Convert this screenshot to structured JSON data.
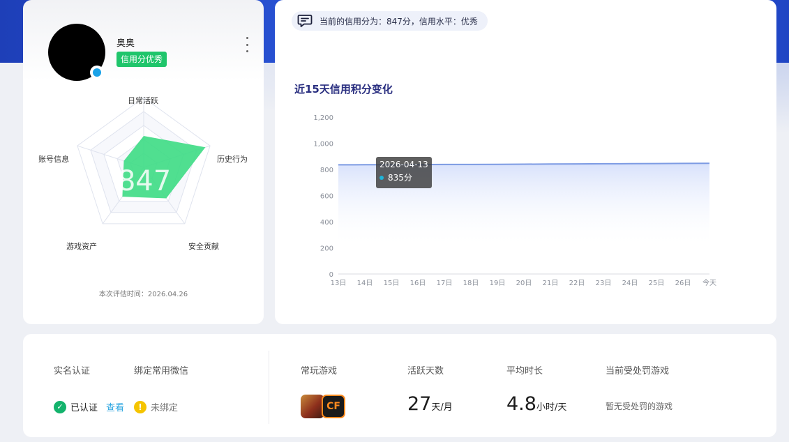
{
  "profile": {
    "nickname": "奥奥",
    "credit_tag": "信用分优秀",
    "score_watermark": "847",
    "eval_time": "本次评估时间：2026.04.26",
    "radar": {
      "axes": [
        "日常活跃",
        "历史行为",
        "安全贡献",
        "游戏资产",
        "账号信息"
      ],
      "values": [
        0.45,
        0.93,
        0.55,
        0.52,
        0.3
      ],
      "fill_color": "#3ddc84"
    }
  },
  "notice": {
    "text": "当前的信用分为：847分，信用水平：优秀"
  },
  "chart": {
    "title": "近15天信用积分变化"
  },
  "chart_data": {
    "type": "area",
    "title": "近15天信用积分变化",
    "x": [
      "13日",
      "14日",
      "15日",
      "16日",
      "17日",
      "18日",
      "19日",
      "20日",
      "21日",
      "22日",
      "23日",
      "24日",
      "25日",
      "26日",
      "今天"
    ],
    "series": [
      {
        "values": [
          835,
          836,
          836,
          837,
          838,
          838,
          839,
          840,
          841,
          842,
          843,
          844,
          845,
          846,
          847
        ]
      }
    ],
    "y_ticks": [
      "0",
      "200",
      "400",
      "600",
      "800",
      "1,000",
      "1,200"
    ],
    "ylim": [
      0,
      1200
    ],
    "line_color": "#7d9be3",
    "fill_color": "#dbe4fb",
    "tooltip": {
      "date": "2026-04-13",
      "value": "835分"
    }
  },
  "bottom": {
    "realname_label": "实名认证",
    "wechat_label": "绑定常用微信",
    "verified_text": "已认证",
    "view_link": "查看",
    "unbound_text": "未绑定",
    "games_label": "常玩游戏",
    "game_2_text": "CF",
    "active_days_label": "活跃天数",
    "active_days_value": "27",
    "active_days_unit": "天/月",
    "avg_time_label": "平均时长",
    "avg_time_value": "4.8",
    "avg_time_unit": "小时/天",
    "penalty_label": "当前受处罚游戏",
    "penalty_value": "暂无受处罚的游戏"
  }
}
